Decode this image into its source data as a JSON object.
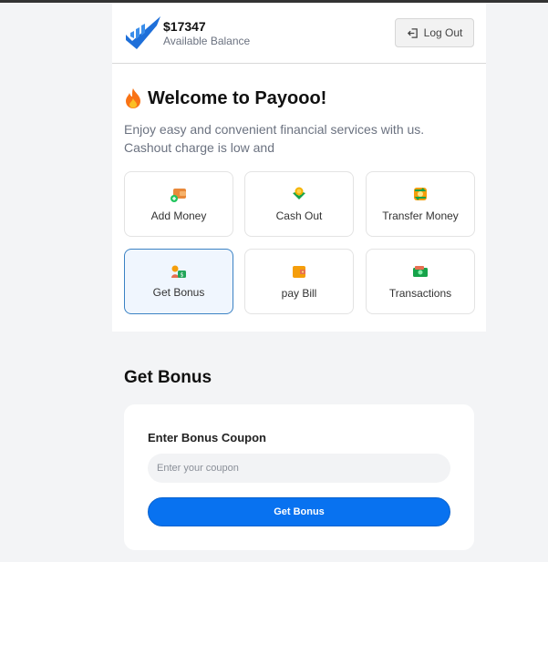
{
  "header": {
    "balance": "$17347",
    "balance_label": "Available Balance",
    "logout_label": "Log Out",
    "logo_icon": "check-chart-logo",
    "logout_icon": "logout-arrow-icon"
  },
  "welcome": {
    "title": "Welcome to Payooo!",
    "icon": "fire-icon",
    "description": "Enjoy easy and convenient financial services with us. Cashout charge is low and"
  },
  "services": [
    {
      "label": "Add Money",
      "icon": "wallet-add-icon",
      "active": false
    },
    {
      "label": "Cash Out",
      "icon": "cash-out-icon",
      "active": false
    },
    {
      "label": "Transfer Money",
      "icon": "transfer-icon",
      "active": false
    },
    {
      "label": "Get Bonus",
      "icon": "bonus-icon",
      "active": true
    },
    {
      "label": "pay Bill",
      "icon": "bill-icon",
      "active": false
    },
    {
      "label": "Transactions",
      "icon": "transactions-icon",
      "active": false
    }
  ],
  "bonus": {
    "section_title": "Get Bonus",
    "field_label": "Enter Bonus Coupon",
    "placeholder": "Enter your coupon",
    "value": "",
    "button_label": "Get Bonus"
  },
  "colors": {
    "accent": "#0872f0",
    "active_tile_border": "#3b82c4",
    "page_bg": "#f3f4f6"
  }
}
